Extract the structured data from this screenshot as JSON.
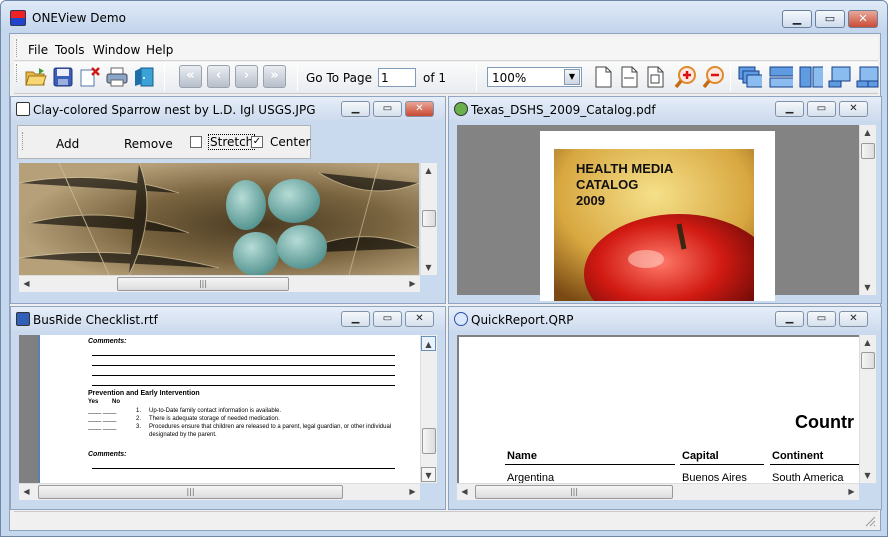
{
  "app": {
    "title": "ONEView Demo"
  },
  "menu": [
    "File",
    "Tools",
    "Window",
    "Help"
  ],
  "toolbar": {
    "goto_label": "Go To Page",
    "page_value": "1",
    "of_label": "of 1",
    "zoom_value": "100%"
  },
  "windows": {
    "image": {
      "title": "Clay-colored Sparrow nest by L.D. Igl USGS.JPG",
      "add_label": "Add",
      "remove_label": "Remove",
      "stretch_label": "Stretch",
      "center_label": "Center"
    },
    "pdf": {
      "title": "Texas_DSHS_2009_Catalog.pdf",
      "cover_line1": "HEALTH MEDIA",
      "cover_line2": "CATALOG",
      "cover_line3": "2009"
    },
    "rtf": {
      "title": "BusRide Checklist.rtf",
      "comments_label": "Comments:",
      "section_title": "Prevention and Early Intervention",
      "yes_label": "Yes",
      "no_label": "No",
      "items": [
        {
          "num": "1.",
          "text": "Up-to-Date family contact information is available."
        },
        {
          "num": "2.",
          "text": "There is adequate storage of needed medication."
        },
        {
          "num": "3.",
          "text": "Procedures ensure that children are released to a parent, legal guardian, or other individual designated by the parent."
        }
      ],
      "comments_label2": "Comments:"
    },
    "report": {
      "title": "QuickReport.QRP",
      "heading": "Countr",
      "headers": [
        "Name",
        "Capital",
        "Continent"
      ],
      "row": [
        "Argentina",
        "Buenos Aires",
        "South America"
      ]
    }
  }
}
